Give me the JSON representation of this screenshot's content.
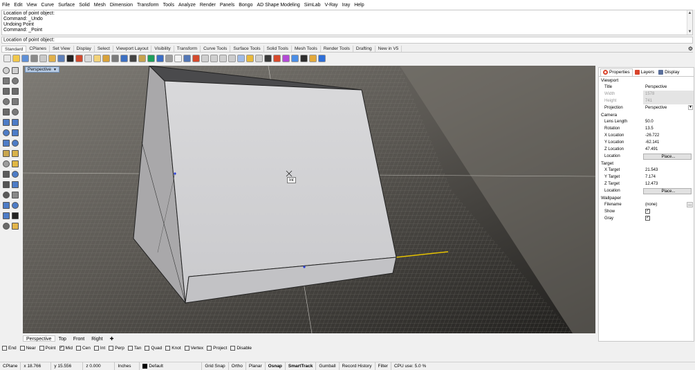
{
  "menu": [
    "File",
    "Edit",
    "View",
    "Curve",
    "Surface",
    "Solid",
    "Mesh",
    "Dimension",
    "Transform",
    "Tools",
    "Analyze",
    "Render",
    "Panels",
    "Bongo",
    "AD Shape Modeling",
    "SimLab",
    "V-Ray",
    "Iray",
    "Help"
  ],
  "command_history": [
    "Location of point object:",
    "Command: _Undo",
    "Undoing Point",
    "Command: _Point"
  ],
  "command_prompt": "Location of point object:",
  "toolbar_tabs": [
    "Standard",
    "CPlanes",
    "Set View",
    "Display",
    "Select",
    "Viewport Layout",
    "Visibility",
    "Transform",
    "Curve Tools",
    "Surface Tools",
    "Solid Tools",
    "Mesh Tools",
    "Render Tools",
    "Drafting",
    "New in V5"
  ],
  "active_toolbar_tab": "Standard",
  "viewport": {
    "label": "Perspective",
    "snap_tooltip": "Int",
    "tabs": [
      "Perspective",
      "Top",
      "Front",
      "Right"
    ],
    "active_tab": "Perspective"
  },
  "panel": {
    "tabs": [
      "Properties",
      "Layers",
      "Display"
    ],
    "active_tab": "Properties",
    "sections": {
      "viewport": "Viewport",
      "camera": "Camera",
      "target": "Target",
      "wallpaper": "Wallpaper"
    },
    "viewport_rows": {
      "title_k": "Title",
      "title_v": "Perspective",
      "width_k": "Width",
      "width_v": "1578",
      "height_k": "Height",
      "height_v": "741",
      "projection_k": "Projection",
      "projection_v": "Perspective"
    },
    "camera_rows": {
      "lens_k": "Lens Length",
      "lens_v": "50.0",
      "rot_k": "Rotation",
      "rot_v": "13.5",
      "xl_k": "X Location",
      "xl_v": "-26.722",
      "yl_k": "Y Location",
      "yl_v": "-62.141",
      "zl_k": "Z Location",
      "zl_v": "47.491",
      "loc_k": "Location",
      "loc_btn": "Place..."
    },
    "target_rows": {
      "xt_k": "X Target",
      "xt_v": "21.543",
      "yt_k": "Y Target",
      "yt_v": "7.174",
      "zt_k": "Z Target",
      "zt_v": "12.473",
      "loc_k": "Location",
      "loc_btn": "Place..."
    },
    "wallpaper_rows": {
      "file_k": "Filename",
      "file_v": "(none)",
      "show_k": "Show",
      "show_checked": true,
      "gray_k": "Gray",
      "gray_checked": true
    }
  },
  "osnaps": [
    {
      "label": "End",
      "checked": false
    },
    {
      "label": "Near",
      "checked": false
    },
    {
      "label": "Point",
      "checked": false
    },
    {
      "label": "Mid",
      "checked": true
    },
    {
      "label": "Cen",
      "checked": false
    },
    {
      "label": "Int",
      "checked": false
    },
    {
      "label": "Perp",
      "checked": false
    },
    {
      "label": "Tan",
      "checked": false
    },
    {
      "label": "Quad",
      "checked": false
    },
    {
      "label": "Knot",
      "checked": false
    },
    {
      "label": "Vertex",
      "checked": false
    },
    {
      "label": "Project",
      "checked": false
    },
    {
      "label": "Disable",
      "checked": false
    }
  ],
  "status": {
    "cplane": "CPlane",
    "x": "x 18.766",
    "y": "y 15.556",
    "z": "z 0.000",
    "units": "Inches",
    "layer": "Default",
    "grid_snap": "Grid Snap",
    "ortho": "Ortho",
    "planar": "Planar",
    "osnap": "Osnap",
    "smarttrack": "SmartTrack",
    "gumball": "Gumball",
    "record_history": "Record History",
    "filter": "Filter",
    "cpu": "CPU use: 5.0 %"
  }
}
